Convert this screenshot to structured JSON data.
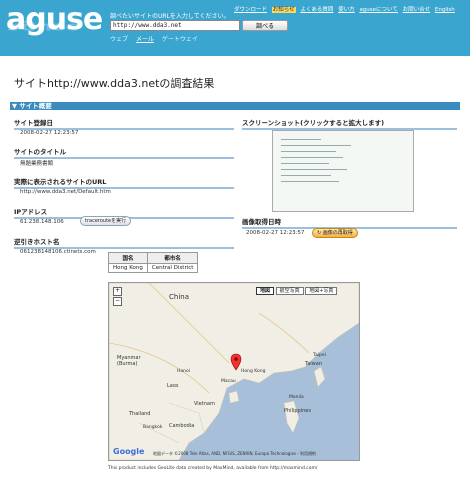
{
  "header": {
    "logo": "aguse",
    "search_hint": "調べたいサイトのURLを入力してください。",
    "search_value": "http://www.dda3.net",
    "search_button": "調べる",
    "tabs": [
      "ウェブ",
      "メール",
      "ゲートウェイ"
    ],
    "nav": [
      "ダウンロード",
      "お知らせ",
      "よくある質問",
      "使い方",
      "aguseについて",
      "お問い合せ",
      "English"
    ]
  },
  "page_title": "サイトhttp://www.dda3.netの調査結果",
  "section_title": "▼ サイト概要",
  "fields": {
    "registered_label": "サイト登録日",
    "registered_value": "2008-02-27 12:23:57",
    "title_label": "サイトのタイトル",
    "title_value": "無題業務書類",
    "url_label": "実際に表示されるサイトのURL",
    "url_value": "http://www.dda3.net/Default.htm",
    "ip_label": "IPアドレス",
    "ip_value": "61.238.148.106",
    "traceroute_button": "tracerouteを実行",
    "host_label": "逆引きホスト名",
    "host_value": "061238148106.ctinets.com",
    "screenshot_label": "スクリーンショット(クリックすると拡大します)",
    "capture_label": "画像取得日時",
    "capture_value": "2008-02-27 12:23:57",
    "reacquire_button": "画像の再取得"
  },
  "country_table": {
    "headers": [
      "国名",
      "都市名"
    ],
    "row": [
      "Hong Kong",
      "Central District"
    ]
  },
  "map": {
    "type_buttons": [
      "地図",
      "航空写真",
      "地図+写真"
    ],
    "labels": {
      "china": "China",
      "myanmar": "Myanmar (Burma)",
      "laos": "Laos",
      "vietnam": "Vietnam",
      "thailand": "Thailand",
      "cambodia": "Cambodia",
      "philippines": "Philippines",
      "taiwan": "Taiwan",
      "hongkong": "Hong Kong",
      "macau": "Macau",
      "hanoi": "Hanoi",
      "bangkok": "Bangkok",
      "manila": "Manila",
      "taipei": "Taipei"
    },
    "attribution": "地図データ ©2008 Tele Atlas, AND, NFGIS, ZENRIN, Europa Technologies - 利用規約",
    "google": "Google"
  },
  "footer_note": "This product includes GeoLite data created by MaxMind, available from http://maxmind.com/",
  "colors": {
    "header_bg": "#3aa6cf",
    "section_bar": "#3a8cbf",
    "marker": "#e33"
  }
}
